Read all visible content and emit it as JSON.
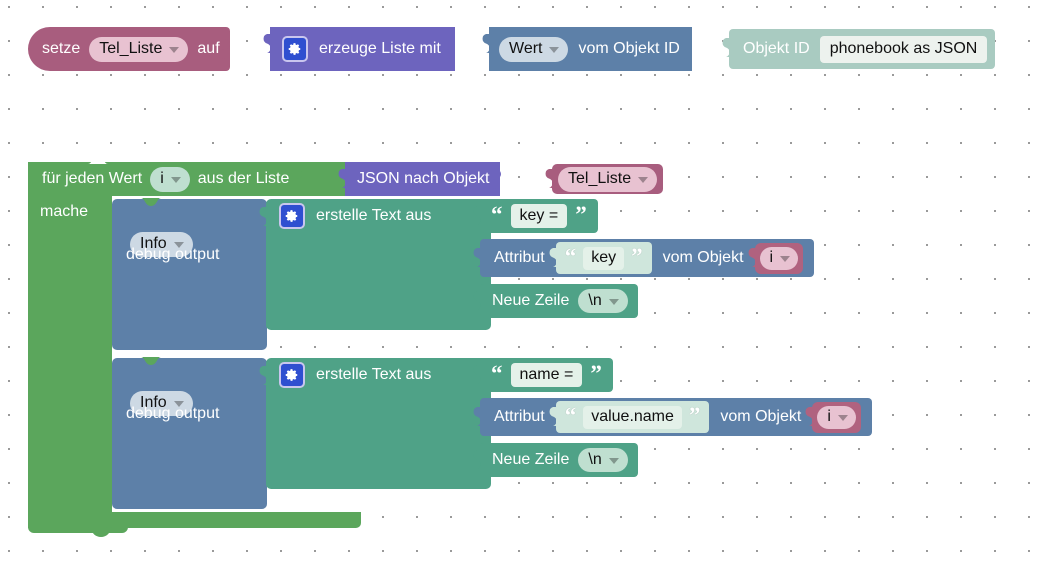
{
  "editor": {
    "kind": "blockly-workspace",
    "background": "#ffffff",
    "grid_dot_color": "#9a9a9a"
  },
  "colors": {
    "variable": "#a85d7e",
    "list_purple": "#6d64be",
    "object_slate": "#5d80a8",
    "objectid_mint": "#a9cbc1",
    "loop_green": "#5ba65c",
    "text_teal": "#4fa287",
    "gear_button": "#2f4fd0"
  },
  "statement_set_variable": {
    "set_label": "setze",
    "variable": "Tel_Liste",
    "to_label": "auf",
    "create_list_label": "erzeuge Liste mit",
    "gear_icon": "gear-icon",
    "value_dropdown": "Wert",
    "from_object_id_label": "vom Objekt ID",
    "object_id_label": "Objekt ID",
    "object_id_value": "phonebook as JSON"
  },
  "loop": {
    "for_each_label": "für jeden Wert",
    "iterator_variable": "i",
    "from_list_label": "aus der Liste",
    "json_to_object_label": "JSON nach Objekt",
    "json_source_variable": "Tel_Liste",
    "do_label": "mache"
  },
  "debug_blocks": [
    {
      "title": "debug output",
      "severity": "Info",
      "gear_icon": "gear-icon",
      "create_text_label": "erstelle Text aus",
      "rows": [
        {
          "type": "text",
          "value": "key = "
        },
        {
          "type": "attribute",
          "attribute_label": "Attribut",
          "attribute_name": "key",
          "from_object_label": "vom Objekt",
          "object_variable": "i"
        },
        {
          "type": "newline",
          "label": "Neue Zeile",
          "value": "\\n"
        }
      ]
    },
    {
      "title": "debug output",
      "severity": "Info",
      "gear_icon": "gear-icon",
      "create_text_label": "erstelle Text aus",
      "rows": [
        {
          "type": "text",
          "value": "name = "
        },
        {
          "type": "attribute",
          "attribute_label": "Attribut",
          "attribute_name": "value.name",
          "from_object_label": "vom Objekt",
          "object_variable": "i"
        },
        {
          "type": "newline",
          "label": "Neue Zeile",
          "value": "\\n"
        }
      ]
    }
  ]
}
